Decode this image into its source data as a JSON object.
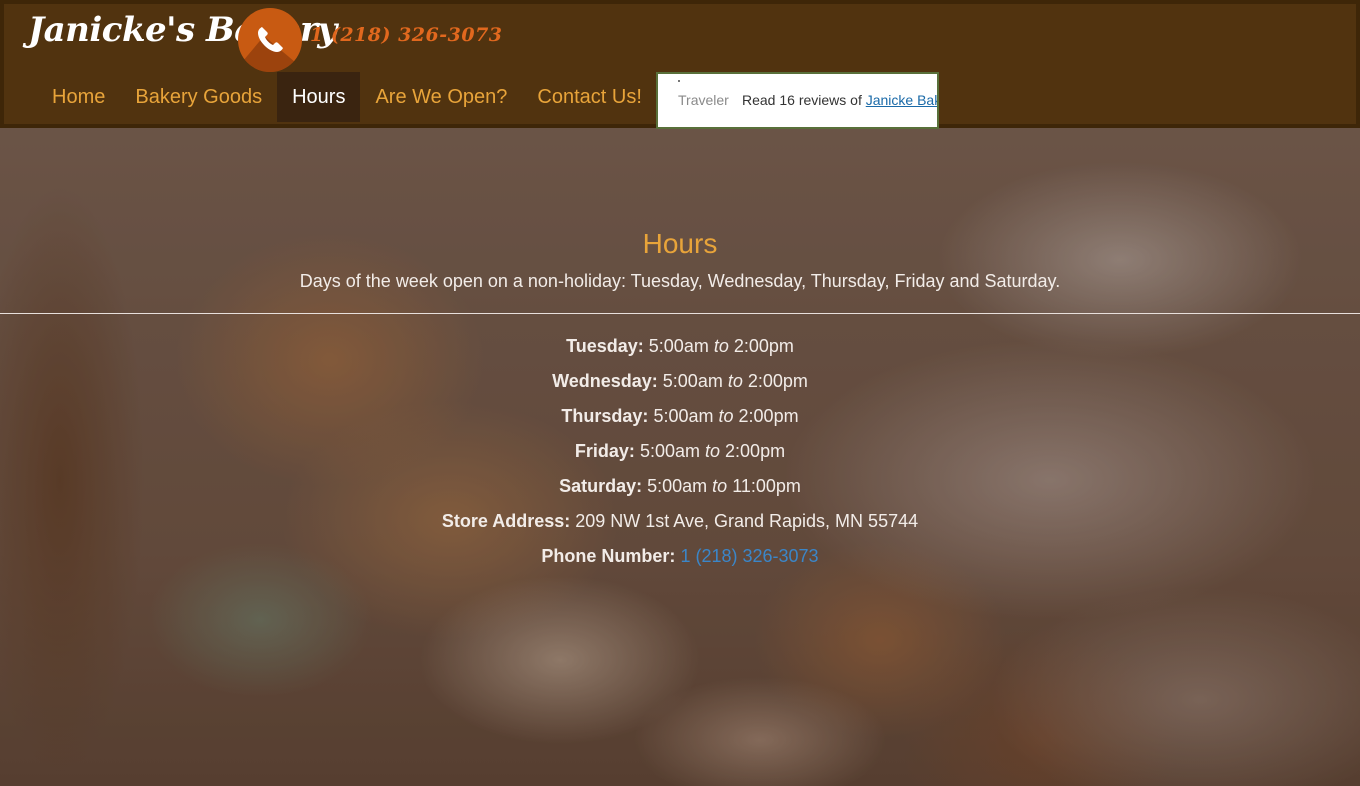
{
  "header": {
    "brand": "Janicke's Bakery",
    "phone": "1 (218) 326-3073",
    "nav": [
      {
        "label": "Home"
      },
      {
        "label": "Bakery Goods"
      },
      {
        "label": "Hours"
      },
      {
        "label": "Are We Open?"
      },
      {
        "label": "Contact Us!"
      }
    ],
    "active_nav": "Hours",
    "review_widget": {
      "brand": "Traveler",
      "read_prefix": "Read 16 reviews of",
      "link_text": "Janicke Bak"
    }
  },
  "main": {
    "title": "Hours",
    "subtitle": "Days of the week open on a non-holiday: Tuesday, Wednesday, Thursday, Friday and Saturday.",
    "schedule": [
      {
        "day": "Tuesday:",
        "open": "5:00am",
        "sep": "to",
        "close": "2:00pm"
      },
      {
        "day": "Wednesday:",
        "open": "5:00am",
        "sep": "to",
        "close": "2:00pm"
      },
      {
        "day": "Thursday:",
        "open": "5:00am",
        "sep": "to",
        "close": "2:00pm"
      },
      {
        "day": "Friday:",
        "open": "5:00am",
        "sep": "to",
        "close": "2:00pm"
      },
      {
        "day": "Saturday:",
        "open": "5:00am",
        "sep": "to",
        "close": "11:00pm"
      }
    ],
    "address_label": "Store Address:",
    "address": "209 NW 1st Ave, Grand Rapids, MN 55744",
    "phone_label": "Phone Number:",
    "phone": "1 (218) 326-3073"
  },
  "colors": {
    "header_bg": "#51330f",
    "accent_orange": "#e8a43a",
    "phone_orange": "#e1681e",
    "link_blue": "#3b86c8"
  },
  "icons": {
    "phone": "phone-icon"
  }
}
